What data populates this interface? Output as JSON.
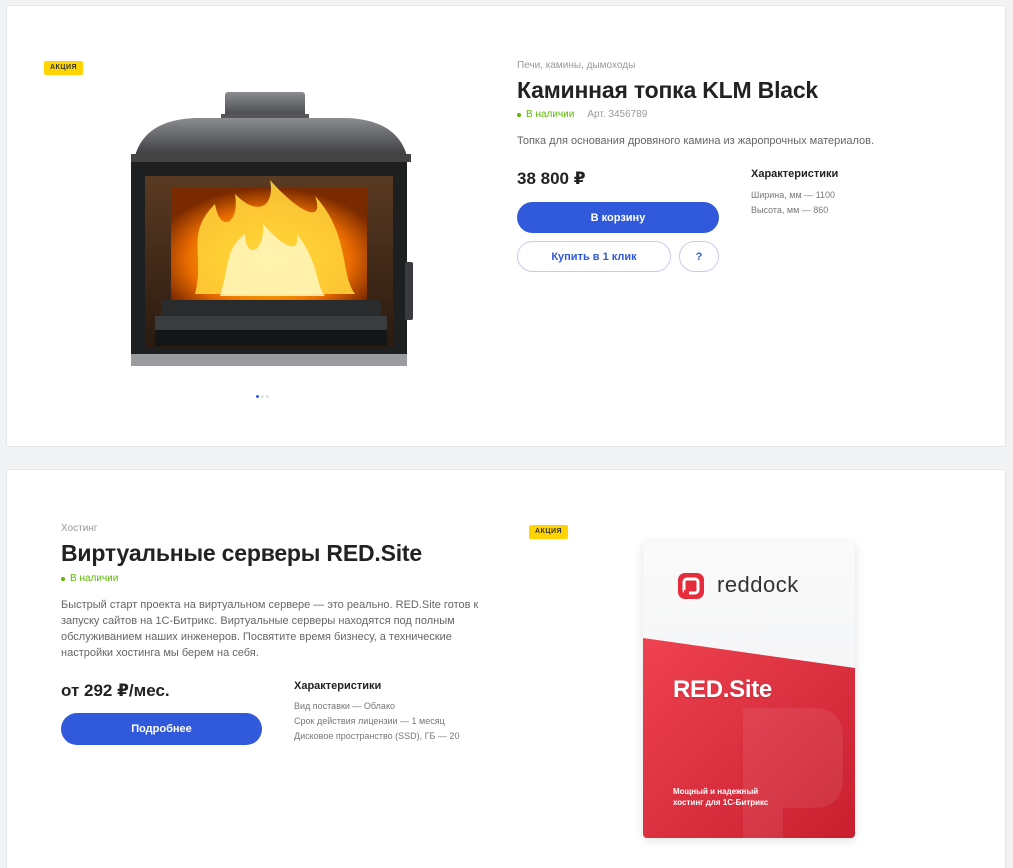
{
  "product1": {
    "badge": "акция",
    "category": "Печи, камины, дымоходы",
    "title": "Каминная топка KLM Black",
    "stock": "В наличии",
    "article": "Арт. 3456789",
    "description": "Топка для основания дровяного камина из жаропрочных материалов.",
    "price": "38 800 ₽",
    "cart_button": "В корзину",
    "one_click_button": "Купить в 1 клик",
    "question_button": "?",
    "specs_title": "Характеристики",
    "specs": [
      "Ширина, мм — 1100",
      "Высота, мм — 860"
    ],
    "gallery_dots": 3,
    "gallery_active": 0
  },
  "product2": {
    "badge": "акция",
    "category": "Хостинг",
    "title": "Виртуальные серверы RED.Site",
    "stock": "В наличии",
    "description_lines": [
      "Быстрый старт проекта на виртуальном сервере — это реально. RED.Site готов к",
      "запуску сайтов на 1С-Битрикс. Виртуальные серверы находятся под полным",
      "обслуживанием наших инженеров. Посвятите время бизнесу, а технические",
      "настройки хостинга мы берем на себя."
    ],
    "price": "от 292 ₽/мес.",
    "more_button": "Подробнее",
    "specs_title": "Характеристики",
    "specs": [
      "Вид поставки — Облако",
      "Срок действия лицензии — 1 месяц",
      "Дисковое пространство (SSD), ГБ — 20"
    ],
    "box": {
      "logo_text": "reddock",
      "product_name": "RED.Site",
      "tagline_lines": [
        "Мощный и надежный",
        "хостинг для 1С-Битрикс"
      ]
    }
  },
  "colors": {
    "accent": "#3159db",
    "badge": "#ffd400",
    "in_stock": "#5eb800",
    "brand_red": "#e52d3c"
  }
}
